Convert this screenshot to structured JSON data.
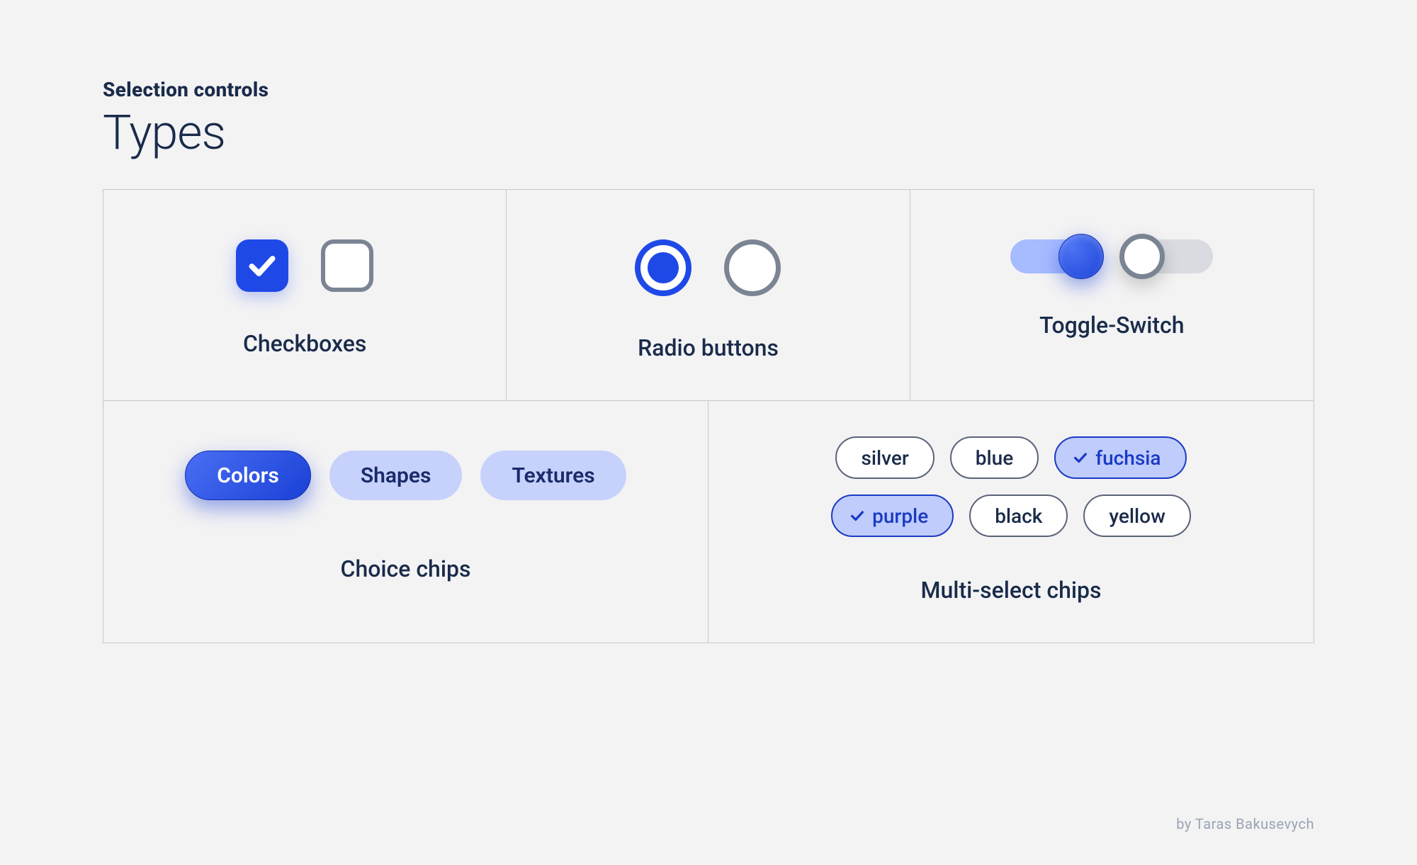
{
  "header": {
    "eyebrow": "Selection controls",
    "title": "Types"
  },
  "cells": {
    "checkboxes": {
      "label": "Checkboxes"
    },
    "radio": {
      "label": "Radio buttons"
    },
    "toggle": {
      "label": "Toggle-Switch"
    },
    "choice": {
      "label": "Choice chips",
      "items": [
        {
          "label": "Colors",
          "selected": true
        },
        {
          "label": "Shapes",
          "selected": false
        },
        {
          "label": "Textures",
          "selected": false
        }
      ]
    },
    "multi": {
      "label": "Multi-select chips",
      "items": [
        {
          "label": "silver",
          "selected": false
        },
        {
          "label": "blue",
          "selected": false
        },
        {
          "label": "fuchsia",
          "selected": true
        },
        {
          "label": "purple",
          "selected": true
        },
        {
          "label": "black",
          "selected": false
        },
        {
          "label": "yellow",
          "selected": false
        }
      ]
    }
  },
  "credit": "by Taras Bakusevych"
}
